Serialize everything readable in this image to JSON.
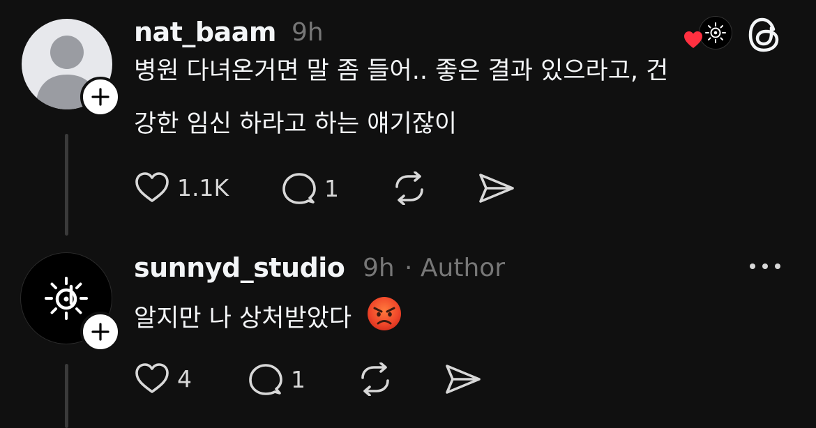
{
  "replies": [
    {
      "username": "nat_baam",
      "time": "9h",
      "text_lines": [
        "병원 다녀온거면 말 좀 들어.. 좋은 결과 있으라고, 건",
        "강한 임신 하라고 하는 얘기잖이"
      ],
      "likes": "1.1K",
      "comments": "1"
    },
    {
      "username": "sunnyd_studio",
      "time": "9h",
      "author_label": "· Author",
      "text": "알지만 나 상처받았다",
      "emoji_name": "angry-face-emoji",
      "likes": "4",
      "comments": "1"
    }
  ],
  "colors": {
    "background": "#101010",
    "text": "#f3f5f7",
    "muted": "#777777",
    "like_heart": "#ff3040"
  }
}
